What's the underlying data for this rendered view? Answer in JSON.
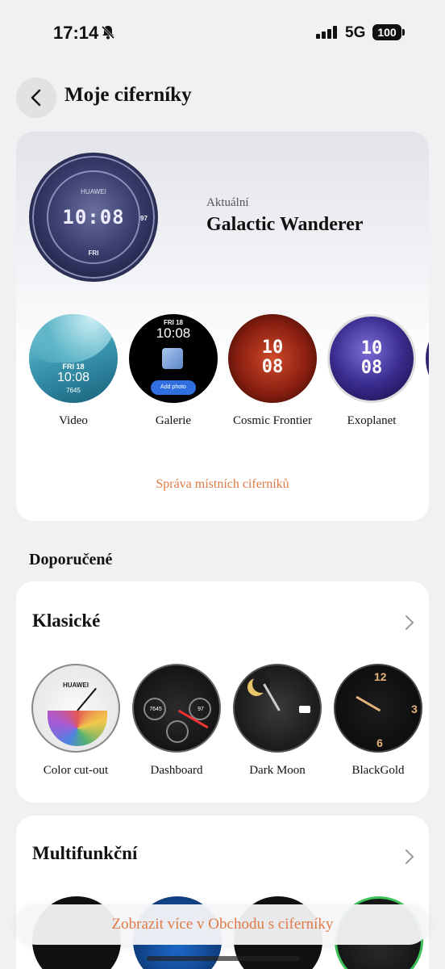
{
  "status": {
    "time": "17:14",
    "network": "5G",
    "battery": "100"
  },
  "header": {
    "title": "Moje ciferníky"
  },
  "current": {
    "label": "Aktuální",
    "name": "Galactic Wanderer",
    "face": {
      "brand": "HUAWEI",
      "time": "10:08",
      "day": "FRI",
      "bpm": "97"
    }
  },
  "my_faces": [
    {
      "label": "Video",
      "date": "FRI 18",
      "time": "10:08",
      "steps": "7645"
    },
    {
      "label": "Galerie",
      "date": "FRI 18",
      "time": "10:08",
      "button": "Add photo"
    },
    {
      "label": "Cosmic Frontier",
      "time": "10\n08"
    },
    {
      "label": "Exoplanet",
      "time": "10\n08"
    }
  ],
  "manage_link": "Správa místních ciferníků",
  "recommended": {
    "title": "Doporučené"
  },
  "classic": {
    "title": "Klasické",
    "faces": [
      {
        "label": "Color cut-out",
        "brand": "HUAWEI"
      },
      {
        "label": "Dashboard",
        "steps": "7645",
        "bpm": "97"
      },
      {
        "label": "Dark Moon"
      },
      {
        "label": "BlackGold"
      }
    ]
  },
  "multi": {
    "title": "Multifunkční",
    "faces": [
      "",
      "",
      "",
      ""
    ]
  },
  "store_button": "Zobrazit více v Obchodu s ciferníky",
  "colors": {
    "accent": "#e07a45",
    "background": "#f1f1f3"
  }
}
